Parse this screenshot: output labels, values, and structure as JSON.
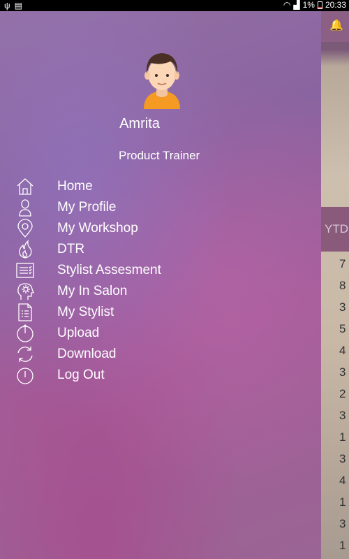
{
  "status_bar": {
    "battery_text": "1%",
    "time": "20:33"
  },
  "profile": {
    "name": "Amrita",
    "role": "Product Trainer"
  },
  "menu": [
    {
      "label": "Home",
      "icon": "home-icon"
    },
    {
      "label": "My Profile",
      "icon": "person-icon"
    },
    {
      "label": "My Workshop",
      "icon": "location-pin-icon"
    },
    {
      "label": "DTR",
      "icon": "flame-icon"
    },
    {
      "label": "Stylist Assesment",
      "icon": "checklist-icon"
    },
    {
      "label": "My In Salon",
      "icon": "head-gear-icon"
    },
    {
      "label": "My Stylist",
      "icon": "document-icon"
    },
    {
      "label": "Upload",
      "icon": "upload-icon"
    },
    {
      "label": "Download",
      "icon": "refresh-icon"
    },
    {
      "label": "Log Out",
      "icon": "power-icon"
    }
  ],
  "background_screen": {
    "column_header": "YTD",
    "values": [
      "7",
      "8",
      "3",
      "5",
      "4",
      "3",
      "2",
      "3",
      "1",
      "3",
      "4",
      "1",
      "3",
      "1"
    ]
  }
}
